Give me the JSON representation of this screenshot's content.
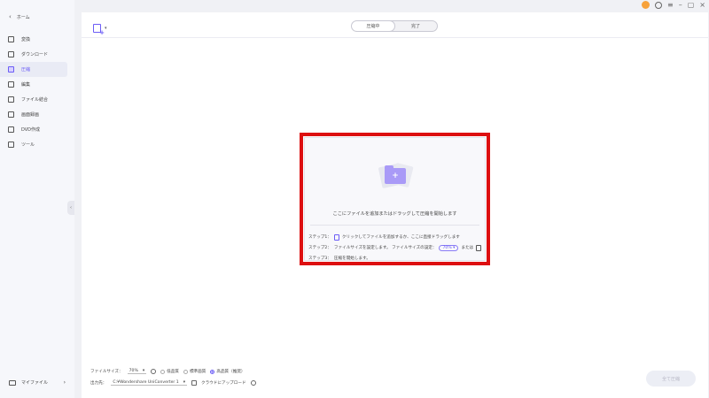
{
  "sidebar": {
    "back_label": "ホーム",
    "items": [
      {
        "label": "変換",
        "icon": "convert-icon"
      },
      {
        "label": "ダウンロード",
        "icon": "download-icon"
      },
      {
        "label": "圧縮",
        "icon": "compress-icon"
      },
      {
        "label": "編集",
        "icon": "scissors-icon"
      },
      {
        "label": "ファイル結合",
        "icon": "merge-icon"
      },
      {
        "label": "画面録画",
        "icon": "screen-record-icon"
      },
      {
        "label": "DVD作成",
        "icon": "dvd-icon"
      },
      {
        "label": "ツール",
        "icon": "tools-icon"
      }
    ],
    "active_index": 2,
    "my_files_label": "マイファイル"
  },
  "tabs": {
    "compressing": "圧縮中",
    "done": "完了"
  },
  "dropzone": {
    "prompt": "ここにファイルを追加またはドラッグして圧縮を開始します",
    "step1_prefix": "ステップ1：",
    "step1_text": "クリックしてファイルを追加するか、ここに直接ドラッグします",
    "step2_prefix": "ステップ2：",
    "step2_text": "ファイルサイズを設定します。 ファイルサイズの設定：",
    "step2_value": "70%",
    "step2_or": "または",
    "step3_prefix": "ステップ3：",
    "step3_text": "圧縮を開始します。"
  },
  "bottom": {
    "filesize_label": "ファイルサイズ：",
    "filesize_value": "70%",
    "quality_low": "低品質",
    "quality_standard": "標準画質",
    "quality_high": "高品質（推奨）",
    "output_label": "出力先：",
    "output_path": "C:¥Wondershare UniConverter 1",
    "cloud_upload": "クラウドにアップロード",
    "compress_all": "全て圧縮"
  },
  "colors": {
    "accent": "#6b5cf6",
    "highlight_frame": "#dd0f10"
  }
}
